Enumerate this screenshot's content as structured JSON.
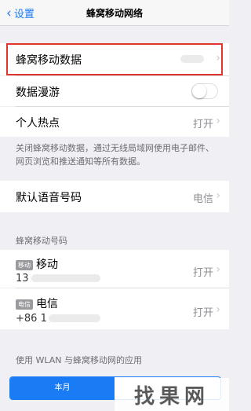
{
  "nav": {
    "back_label": "设置",
    "title": "蜂窝移动网络"
  },
  "cellular_data": {
    "label": "蜂窝移动数据",
    "enabled": true
  },
  "data_roaming": {
    "label": "数据漫游",
    "enabled": false
  },
  "hotspot": {
    "label": "个人热点",
    "value": "打开"
  },
  "footer_note": "关闭蜂窝移动数据，通过无线局域网使用电子邮件、网页浏览和推送通知等所有数据。",
  "default_voice": {
    "label": "默认语音号码",
    "value": "电信"
  },
  "numbers_section": {
    "header": "蜂窝移动号码",
    "lines": [
      {
        "badge": "移动",
        "name": "移动",
        "number": "13",
        "value": "打开"
      },
      {
        "badge": "电信",
        "name": "电信",
        "number": "+86 1",
        "value": "打开"
      }
    ]
  },
  "apps_section": {
    "header": "使用 WLAN 与蜂窝移动网的应用"
  },
  "segmented": {
    "active": "本月",
    "other": ""
  },
  "watermark": "找果网",
  "colors": {
    "accent": "#1a7cf5",
    "highlight": "#e0342c"
  }
}
